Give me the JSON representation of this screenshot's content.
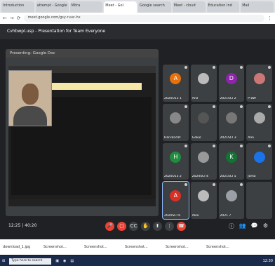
{
  "tabs": [
    "Introduction",
    "attempt - Google",
    "Mitra",
    "Meet - Gol",
    "Google search",
    "Meet - cloud",
    "Education Ind",
    "Mail"
  ],
  "address": "meet.google.com/gsy-ruuc-hx",
  "meeting_title": "Cvhbwpl.usp - Presentation for Team Everyone",
  "presenter_caption": "Presenting: Google Doc",
  "time": "12:25 | 40:20",
  "participants": [
    {
      "name": "2020U13 1",
      "initial": "A",
      "color": "#e8710a"
    },
    {
      "name": "Anil",
      "initial": "",
      "color": "#bbb"
    },
    {
      "name": "2021SCI 2",
      "initial": "D",
      "color": "#8e24aa"
    },
    {
      "name": "P BW",
      "initial": "",
      "color": "#c77"
    },
    {
      "name": "Harvancat",
      "initial": "",
      "color": "#888"
    },
    {
      "name": "Gokul",
      "initial": "",
      "color": "#555"
    },
    {
      "name": "2021SCI 3",
      "initial": "",
      "color": "#777"
    },
    {
      "name": "Ana",
      "initial": "",
      "color": "#aaa"
    },
    {
      "name": "2020U13 2",
      "initial": "H",
      "color": "#1e8e3e"
    },
    {
      "name": "2020SCI 4",
      "initial": "",
      "color": "#999"
    },
    {
      "name": "2021SCI 5",
      "initial": "K",
      "color": "#137333"
    },
    {
      "name": "Jomo",
      "initial": "",
      "color": "#1a73e8"
    },
    {
      "name": "2020SCI 6",
      "initial": "A",
      "color": "#d93025"
    },
    {
      "name": "Alex",
      "initial": "",
      "color": "#bbb"
    },
    {
      "name": "2021 7",
      "initial": "",
      "color": "#9aa0a6"
    },
    {
      "name": "",
      "initial": "",
      "color": "#3c4043"
    }
  ],
  "downloads": [
    "download_1.jpg",
    "Screenshot...",
    "Screenshot...",
    "Screenshot...",
    "Screenshot...",
    "Screenshot..."
  ],
  "taskbar_search": "Type here to search",
  "taskbar_time": "12:30"
}
